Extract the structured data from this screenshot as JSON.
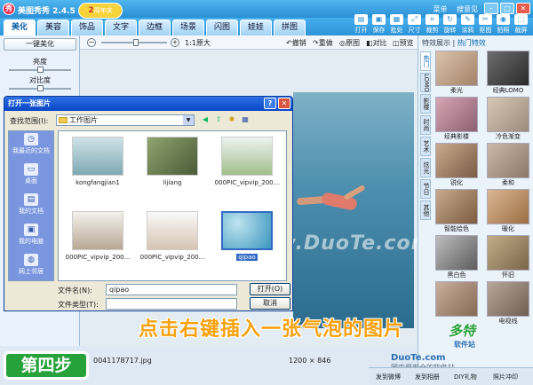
{
  "app": {
    "title": "美图秀秀 2.4.5",
    "logo": "秀"
  },
  "title_links": [
    "菜单",
    "搜意见"
  ],
  "tabs": [
    {
      "label": "美化",
      "active": true
    },
    {
      "label": "美容"
    },
    {
      "label": "饰品"
    },
    {
      "label": "文字"
    },
    {
      "label": "边框"
    },
    {
      "label": "场景"
    },
    {
      "label": "闪图"
    },
    {
      "label": "娃娃"
    },
    {
      "label": "拼图"
    }
  ],
  "hot_badge": {
    "label": "2",
    "sub": "周年庆"
  },
  "toolbar": [
    {
      "label": "打开",
      "icon": "folder-icon"
    },
    {
      "label": "保存",
      "icon": "save-icon"
    },
    {
      "label": "批处",
      "icon": "batch-icon"
    },
    {
      "label": "尺寸",
      "icon": "resize-icon"
    },
    {
      "label": "裁剪",
      "icon": "crop-icon"
    },
    {
      "label": "旋转",
      "icon": "rotate-icon"
    },
    {
      "label": "涂鸦",
      "icon": "doodle-icon"
    },
    {
      "label": "抠图",
      "icon": "cutout-icon"
    },
    {
      "label": "拍照",
      "icon": "camera-icon"
    },
    {
      "label": "截屏",
      "icon": "screenshot-icon"
    }
  ],
  "left_panel": {
    "one_key": "一键美化",
    "brightness": "亮度",
    "contrast": "对比度",
    "brightness_level": 0.5,
    "contrast_level": 0.5
  },
  "edit_toolbar": {
    "zoom": "1:1原大",
    "undo": "撤销",
    "redo": "重做",
    "original": "原图",
    "compare": "对比",
    "preview": "预览",
    "zoom_level": 0.25
  },
  "dialog": {
    "title": "打开一张图片",
    "look_in_label": "查找范围(I):",
    "look_in_value": "工作图片",
    "places": [
      {
        "label": "我最近的文档",
        "icon": "recent-docs-icon"
      },
      {
        "label": "桌面",
        "icon": "desktop-icon"
      },
      {
        "label": "我的文档",
        "icon": "my-documents-icon"
      },
      {
        "label": "我的电脑",
        "icon": "my-computer-icon"
      },
      {
        "label": "网上邻居",
        "icon": "network-icon"
      }
    ],
    "files": [
      {
        "name": "kongfangjian1"
      },
      {
        "name": "lijiang"
      },
      {
        "name": "000PIC_vipvip_200..."
      },
      {
        "name": "000PIC_vipvip_200..."
      },
      {
        "name": "000PIC_vipvip_200..."
      },
      {
        "name": "qipao",
        "selected": true
      }
    ],
    "filename_label": "文件名(N):",
    "filename_value": "qipao",
    "filetype_label": "文件类型(T):",
    "filetype_value": "",
    "open_button": "打开(O)",
    "cancel_button": "取消"
  },
  "right_panel": {
    "header_prefix": "特效展示",
    "header_active": "热门特效",
    "vtabs": [
      "热门",
      "LOMO",
      "影楼",
      "时尚",
      "艺术",
      "炫光",
      "节日",
      "其他"
    ],
    "effects": [
      "柔光",
      "经典LOMO",
      "经典影楼",
      "冷色渐变",
      "锐化",
      "柔和",
      "智能绘色",
      "暖化",
      "黑白色",
      "怀旧",
      "",
      "电视线"
    ]
  },
  "status": {
    "filename": "0041178717.jpg",
    "size": "1200 × 846"
  },
  "canvas": {
    "watermark": "www.DuoTe.com"
  },
  "caption": "点击右键插入一张气泡的图片",
  "step_label": "第四步",
  "bottom_bar": [
    "发到微博",
    "发到相册",
    "DIY礼物",
    "照片冲印"
  ],
  "site": {
    "logo": "多特",
    "sub": "软件站",
    "url": "DuoTe.com",
    "slogan": "国内最安全的软件站"
  }
}
